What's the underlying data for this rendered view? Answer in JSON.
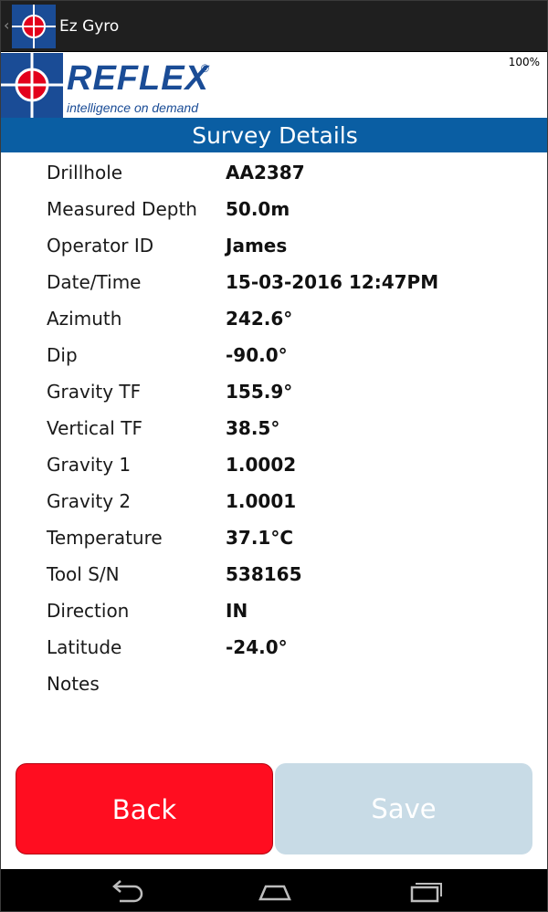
{
  "app": {
    "title": "Ez Gyro",
    "battery": "100%"
  },
  "logo": {
    "word": "REFLEX",
    "registered": "®",
    "tagline": "intelligence on demand"
  },
  "page": {
    "title": "Survey Details"
  },
  "details": [
    {
      "label": "Drillhole",
      "value": "AA2387"
    },
    {
      "label": "Measured Depth",
      "value": "50.0m"
    },
    {
      "label": "Operator ID",
      "value": "James"
    },
    {
      "label": "Date/Time",
      "value": "15-03-2016 12:47PM"
    },
    {
      "label": "Azimuth",
      "value": "242.6°"
    },
    {
      "label": "Dip",
      "value": "-90.0°"
    },
    {
      "label": "Gravity TF",
      "value": "155.9°"
    },
    {
      "label": "Vertical TF",
      "value": "38.5°"
    },
    {
      "label": "Gravity 1",
      "value": "1.0002"
    },
    {
      "label": "Gravity 2",
      "value": "1.0001"
    },
    {
      "label": "Temperature",
      "value": "37.1°C"
    },
    {
      "label": "Tool S/N",
      "value": "538165"
    },
    {
      "label": "Direction",
      "value": "IN"
    },
    {
      "label": "Latitude",
      "value": "-24.0°"
    },
    {
      "label": "Notes",
      "value": ""
    }
  ],
  "buttons": {
    "back": "Back",
    "save": "Save"
  },
  "colors": {
    "brand_blue": "#1a4c96",
    "title_bar": "#0a5ea3",
    "back_button": "#ff0d20",
    "save_button_disabled": "#c8dbe6",
    "target_red": "#e3001b"
  },
  "icons": {
    "app": "reflex-target-icon",
    "nav": [
      "back-nav-icon",
      "home-nav-icon",
      "recent-apps-icon"
    ]
  }
}
